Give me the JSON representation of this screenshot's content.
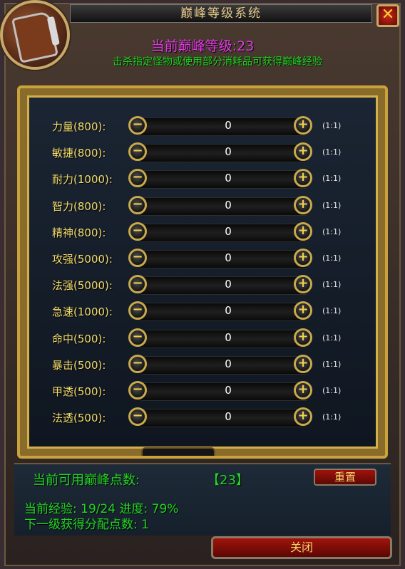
{
  "window": {
    "title": "巅峰等级系统",
    "close_glyph": "✕"
  },
  "header": {
    "level_text": "当前巅峰等级:23",
    "hint_text": "击杀指定怪物或使用部分消耗品可获得巅峰经验"
  },
  "stats": [
    {
      "label": "力量(800):",
      "value": "0",
      "ratio": "(1:1)"
    },
    {
      "label": "敏捷(800):",
      "value": "0",
      "ratio": "(1:1)"
    },
    {
      "label": "耐力(1000):",
      "value": "0",
      "ratio": "(1:1)"
    },
    {
      "label": "智力(800):",
      "value": "0",
      "ratio": "(1:1)"
    },
    {
      "label": "精神(800):",
      "value": "0",
      "ratio": "(1:1)"
    },
    {
      "label": "攻强(5000):",
      "value": "0",
      "ratio": "(1:1)"
    },
    {
      "label": "法强(5000):",
      "value": "0",
      "ratio": "(1:1)"
    },
    {
      "label": "急速(1000):",
      "value": "0",
      "ratio": "(1:1)"
    },
    {
      "label": "命中(500):",
      "value": "0",
      "ratio": "(1:1)"
    },
    {
      "label": "暴击(500):",
      "value": "0",
      "ratio": "(1:1)"
    },
    {
      "label": "甲透(500):",
      "value": "0",
      "ratio": "(1:1)"
    },
    {
      "label": "法透(500):",
      "value": "0",
      "ratio": "(1:1)"
    }
  ],
  "buttons": {
    "minus_glyph": "−",
    "plus_glyph": "+"
  },
  "info": {
    "points_label": "当前可用巅峰点数:",
    "points_value": "【23】",
    "reset_label": "重置",
    "exp_text": "当前经验: 19/24 进度: 79%",
    "next_text": "下一级获得分配点数: 1"
  },
  "footer": {
    "close_label": "关闭"
  },
  "icons": {
    "portrait": "book-icon",
    "window_close": "close-icon",
    "minus": "minus-icon",
    "plus": "plus-icon"
  }
}
